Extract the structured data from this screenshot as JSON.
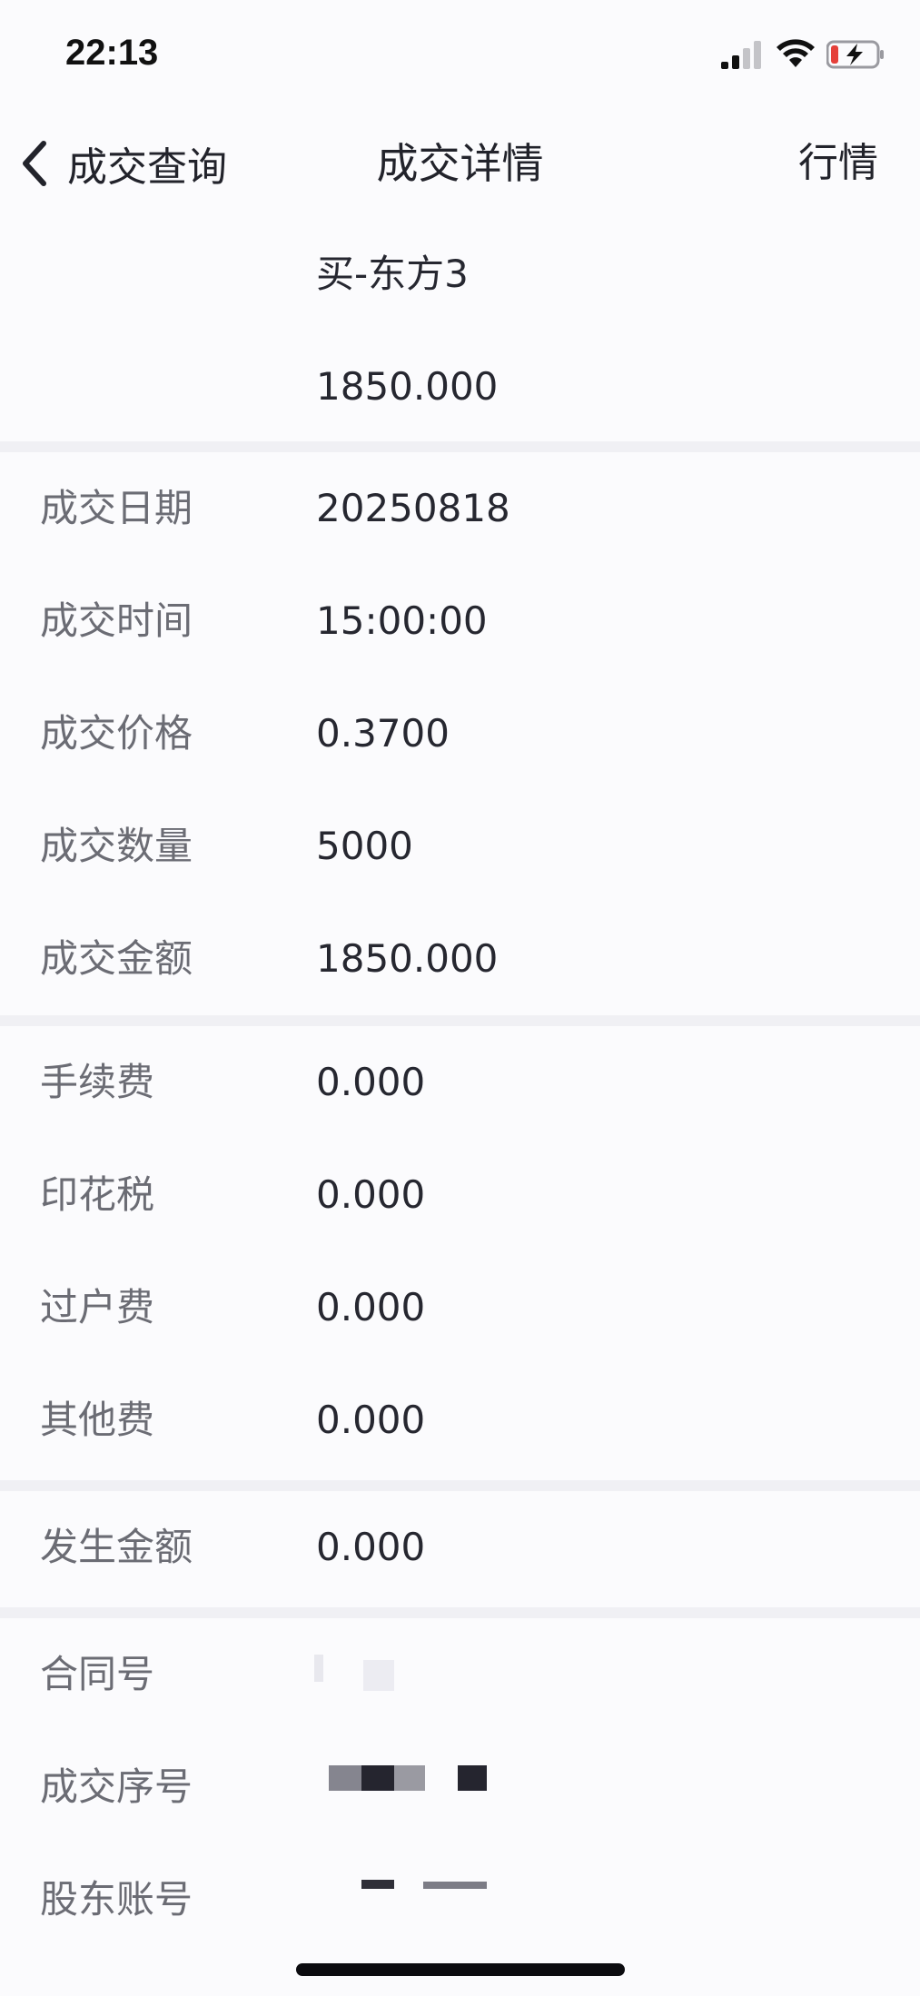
{
  "status_bar": {
    "time": "22:13",
    "icons": [
      "signal-icon",
      "wifi-icon",
      "battery-charging-icon"
    ]
  },
  "nav": {
    "back_label": "成交查询",
    "title": "成交详情",
    "right_label": "行情"
  },
  "header": {
    "name": "买-东方3",
    "amount": "1850.000"
  },
  "trade_info": [
    {
      "label": "成交日期",
      "value": "20250818"
    },
    {
      "label": "成交时间",
      "value": "15:00:00"
    },
    {
      "label": "成交价格",
      "value": "0.3700"
    },
    {
      "label": "成交数量",
      "value": "5000"
    },
    {
      "label": "成交金额",
      "value": "1850.000"
    }
  ],
  "fees": [
    {
      "label": "手续费",
      "value": "0.000"
    },
    {
      "label": "印花税",
      "value": "0.000"
    },
    {
      "label": "过户费",
      "value": "0.000"
    },
    {
      "label": "其他费",
      "value": "0.000"
    }
  ],
  "settlement": [
    {
      "label": "发生金额",
      "value": "0.000"
    }
  ],
  "ids": [
    {
      "label": "合同号"
    },
    {
      "label": "成交序号"
    },
    {
      "label": "股东账号"
    }
  ],
  "colors": {
    "background": "#fbfbfd",
    "divider": "#f0f0f4",
    "label": "#6b6c74",
    "value": "#262730"
  }
}
